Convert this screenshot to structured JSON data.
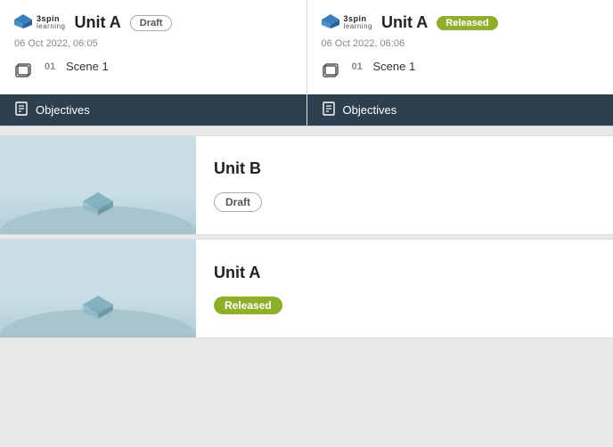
{
  "topCards": [
    {
      "logoLine1": "3spin",
      "logoLine2": "learning",
      "unitTitle": "Unit A",
      "badge": "Draft",
      "badgeType": "draft",
      "date": "06 Oct 2022, 06:05",
      "sceneNum": "01",
      "sceneLabel": "Scene 1",
      "objectivesLabel": "Objectives"
    },
    {
      "logoLine1": "3spin",
      "logoLine2": "learning",
      "unitTitle": "Unit A",
      "badge": "Released",
      "badgeType": "released",
      "date": "06 Oct 2022, 06:06",
      "sceneNum": "01",
      "sceneLabel": "Scene 1",
      "objectivesLabel": "Objectives"
    }
  ],
  "listItems": [
    {
      "unitTitle": "Unit B",
      "badge": "Draft",
      "badgeType": "draft"
    },
    {
      "unitTitle": "Unit A",
      "badge": "Released",
      "badgeType": "released"
    }
  ],
  "icons": {
    "hat": "🎓",
    "clipboard": "📋",
    "bookStack": "📚"
  }
}
